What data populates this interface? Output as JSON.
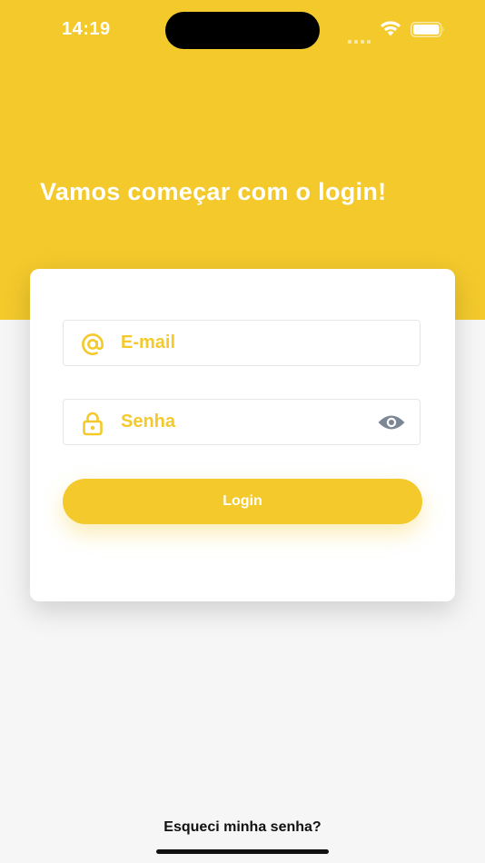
{
  "status_bar": {
    "time": "14:19"
  },
  "header": {
    "title": "Vamos começar com o login!"
  },
  "form": {
    "email": {
      "placeholder": "E-mail",
      "value": "",
      "icon": "at-icon"
    },
    "password": {
      "placeholder": "Senha",
      "value": "",
      "icon": "lock-icon",
      "toggle_icon": "eye-icon"
    },
    "login_label": "Login"
  },
  "footer": {
    "forgot_password": "Esqueci minha senha?"
  },
  "colors": {
    "brand_yellow": "#f3c92c",
    "background": "#f6f6f6",
    "card": "#ffffff",
    "eye_icon": "#7c8796"
  }
}
